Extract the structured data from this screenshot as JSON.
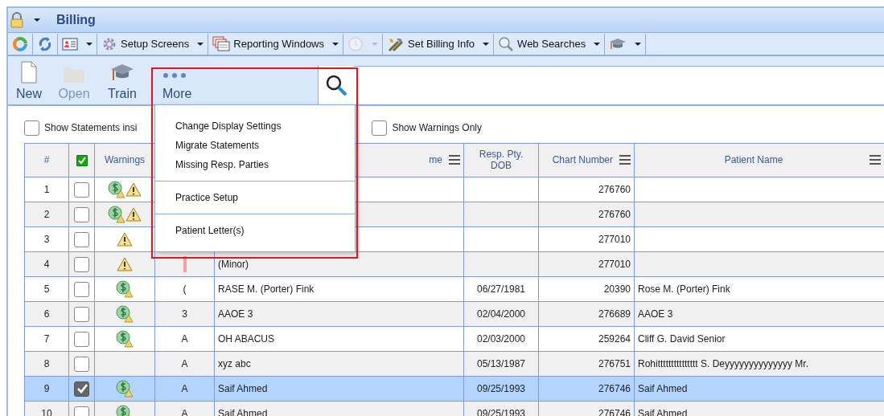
{
  "window": {
    "title": "Billing"
  },
  "toolbar": [
    {
      "dropdown": false,
      "disabled": false
    },
    {
      "dropdown": false,
      "disabled": false
    },
    {
      "dropdown": true,
      "disabled": false
    },
    {
      "label": "Setup Screens",
      "dropdown": true,
      "disabled": false
    },
    {
      "label": "Reporting Windows",
      "dropdown": true,
      "disabled": false
    },
    {
      "dropdown": true,
      "disabled": true
    },
    {
      "label": "Set Billing Info",
      "dropdown": true,
      "disabled": false
    },
    {
      "label": "Web Searches",
      "dropdown": true,
      "disabled": false
    },
    {
      "dropdown": true,
      "disabled": false
    }
  ],
  "ribbon": [
    {
      "label": "New",
      "disabled": false,
      "expanded": false
    },
    {
      "label": "Open",
      "disabled": true,
      "expanded": false
    },
    {
      "label": "Train",
      "disabled": false,
      "expanded": false
    },
    {
      "label": "More",
      "disabled": false,
      "expanded": true
    }
  ],
  "menu": {
    "groups": [
      [
        {
          "label": "Change Display Settings"
        },
        {
          "label": "Migrate Statements"
        },
        {
          "label": "Missing Resp. Parties"
        }
      ],
      [
        {
          "label": "Practice Setup"
        }
      ],
      [
        {
          "label": "Patient Letter(s)"
        }
      ]
    ]
  },
  "filters": [
    {
      "label": "Show Statements insi",
      "checked": false
    },
    {
      "label": "Show Warnings Only",
      "checked": false
    }
  ],
  "table": {
    "columns": [
      {
        "label": "#",
        "kind": "text",
        "menu": false
      },
      {
        "kind": "check",
        "checked": true,
        "menu": false
      },
      {
        "label": "Warnings",
        "kind": "text",
        "menu": false
      },
      {
        "kind": "text"
      },
      {
        "label": "me",
        "kind": "text",
        "menu": true
      },
      {
        "label": "Resp. Pty.\nDOB",
        "kind": "text",
        "menu": false
      },
      {
        "label": "Chart Number",
        "kind": "text",
        "menu": true
      },
      {
        "label": "Patient Name",
        "kind": "text",
        "menu": true
      }
    ],
    "rows": [
      {
        "number": "1",
        "checked": false,
        "selected": false,
        "billing_alert": true,
        "warning": true,
        "flagged": false,
        "chart": "276760"
      },
      {
        "number": "2",
        "checked": false,
        "selected": false,
        "billing_alert": true,
        "warning": true,
        "flagged": false,
        "chart": "276760"
      },
      {
        "number": "3",
        "checked": false,
        "selected": false,
        "billing_alert": false,
        "warning": true,
        "flagged": false,
        "chart": "277010"
      },
      {
        "number": "4",
        "checked": false,
        "selected": false,
        "billing_alert": false,
        "warning": true,
        "flagged": true,
        "name": "(Minor)",
        "chart": "277010"
      },
      {
        "number": "5",
        "checked": false,
        "selected": false,
        "billing_alert": true,
        "warning": false,
        "flagged": false,
        "code": "(",
        "name": "RASE M. (Porter) Fink",
        "dob": "06/27/1981",
        "chart": "20390",
        "patient": "Rose M. (Porter) Fink"
      },
      {
        "number": "6",
        "checked": false,
        "selected": false,
        "billing_alert": true,
        "warning": false,
        "flagged": false,
        "code": "3",
        "name": "AAOE 3",
        "dob": "02/04/2000",
        "chart": "276689",
        "patient": "AAOE 3"
      },
      {
        "number": "7",
        "checked": false,
        "selected": false,
        "billing_alert": true,
        "warning": false,
        "flagged": false,
        "code": "A",
        "name": "OH ABACUS",
        "dob": "02/03/2000",
        "chart": "259264",
        "patient": "Cliff G. David Senior"
      },
      {
        "number": "8",
        "checked": false,
        "selected": false,
        "billing_alert": false,
        "warning": false,
        "flagged": false,
        "code": "A",
        "name": "xyz abc",
        "dob": "05/13/1987",
        "chart": "276751",
        "patient": "Rohittttttttttttttt S. Deyyyyyyyyyyyyyy Mr."
      },
      {
        "number": "9",
        "checked": true,
        "selected": true,
        "billing_alert": true,
        "warning": false,
        "flagged": false,
        "code": "A",
        "name": "Saif Ahmed",
        "dob": "09/25/1993",
        "chart": "276746",
        "patient": "Saif Ahmed"
      },
      {
        "number": "10",
        "checked": false,
        "selected": false,
        "billing_alert": true,
        "warning": false,
        "flagged": false,
        "code": "A",
        "name": "Saif Ahmed",
        "dob": "09/25/1993",
        "chart": "276746",
        "patient": "Saif Ahmed"
      }
    ]
  }
}
